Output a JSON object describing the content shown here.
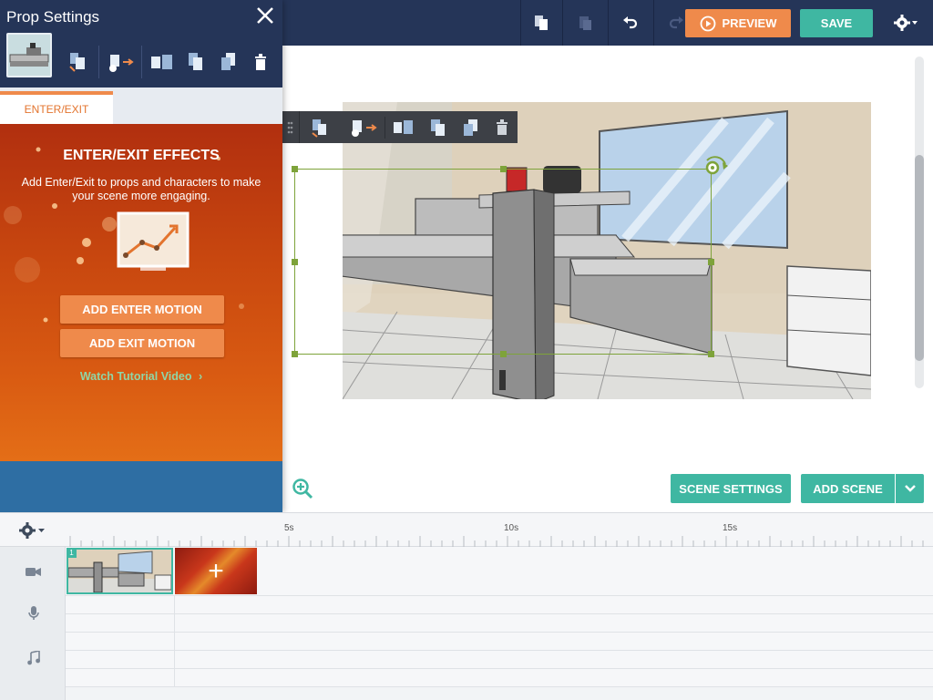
{
  "topbar": {
    "preview_label": "PREVIEW",
    "save_label": "SAVE",
    "icons": [
      "copy-icon",
      "paste-icon",
      "undo-icon",
      "redo-icon",
      "settings-gear-icon"
    ]
  },
  "panel": {
    "title": "Prop Settings",
    "tabs": [
      {
        "label": "ENTER/EXIT",
        "active": true
      }
    ],
    "promo": {
      "title": "ENTER/EXIT EFFECTS",
      "description": "Add Enter/Exit to props and characters to make your scene more engaging.",
      "add_enter_label": "ADD ENTER MOTION",
      "add_exit_label": "ADD EXIT MOTION",
      "tutorial_label": "Watch Tutorial Video",
      "tutorial_chevron": "›"
    }
  },
  "workspace": {
    "scene_settings_label": "SCENE SETTINGS",
    "add_scene_label": "ADD SCENE"
  },
  "timeline": {
    "ticks": [
      "5s",
      "10s",
      "15s"
    ],
    "scene_number": "1",
    "add_clip_symbol": "+"
  },
  "colors": {
    "topbar": "#253558",
    "accent_orange": "#ef8a4b",
    "accent_teal": "#3fb7a2",
    "selection_green": "#7ea33a"
  }
}
